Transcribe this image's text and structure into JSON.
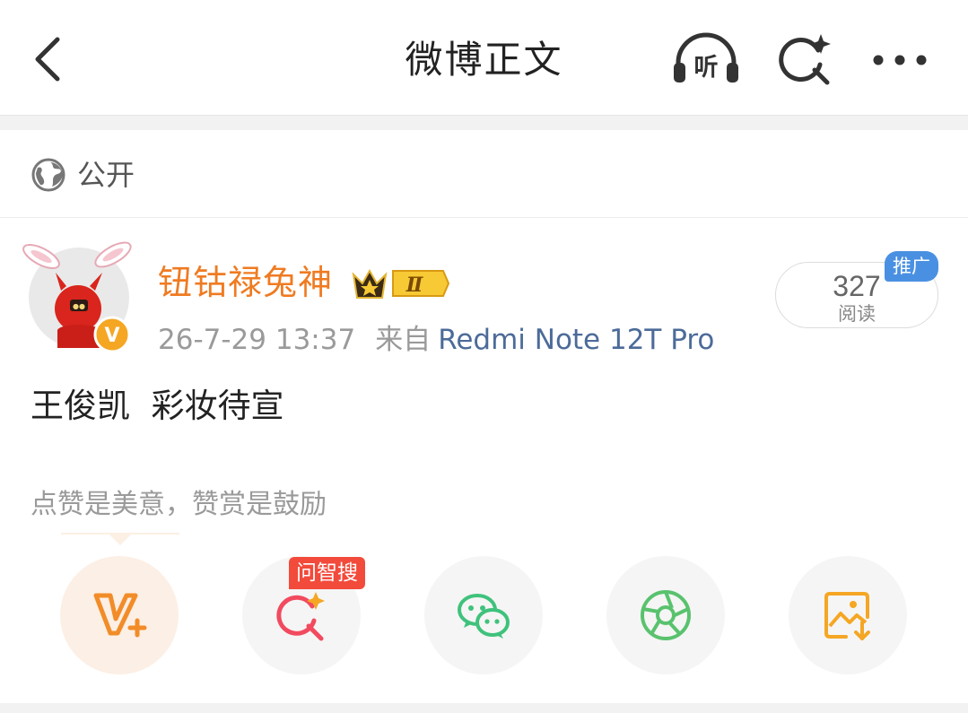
{
  "header": {
    "title": "微博正文",
    "back_icon": "chevron-left-icon",
    "listen_label": "听",
    "listen_icon": "headphones-icon",
    "search_icon": "ai-search-icon",
    "more_icon": "more-dots-icon"
  },
  "visibility": {
    "icon": "globe-icon",
    "label": "公开"
  },
  "author": {
    "name": "钮钴禄兔神",
    "name_color": "#ef7b22",
    "level_badge": "Ⅱ",
    "verified_badge": "V",
    "post_time": "26-7-29 13:37",
    "from_label": "来自",
    "device": "Redmi Note 12T Pro"
  },
  "stats": {
    "read_count": "327",
    "read_label": "阅读",
    "promo_label": "推广"
  },
  "post": {
    "text": "王俊凯  彩妆待宣"
  },
  "encourage": {
    "text": "点赞是美意，赞赏是鼓励"
  },
  "actions": {
    "vplus_icon": "v-plus-icon",
    "ask_icon": "ai-search-icon",
    "ask_tag": "问智搜",
    "wechat_icon": "wechat-icon",
    "moments_icon": "moments-icon",
    "save_icon": "save-image-icon"
  },
  "colors": {
    "orange": "#ef7b22",
    "link_blue": "#4c6b99",
    "promo_blue": "#4a90e2",
    "tag_red": "#f24a3b",
    "wechat_green": "#3fc27c"
  }
}
